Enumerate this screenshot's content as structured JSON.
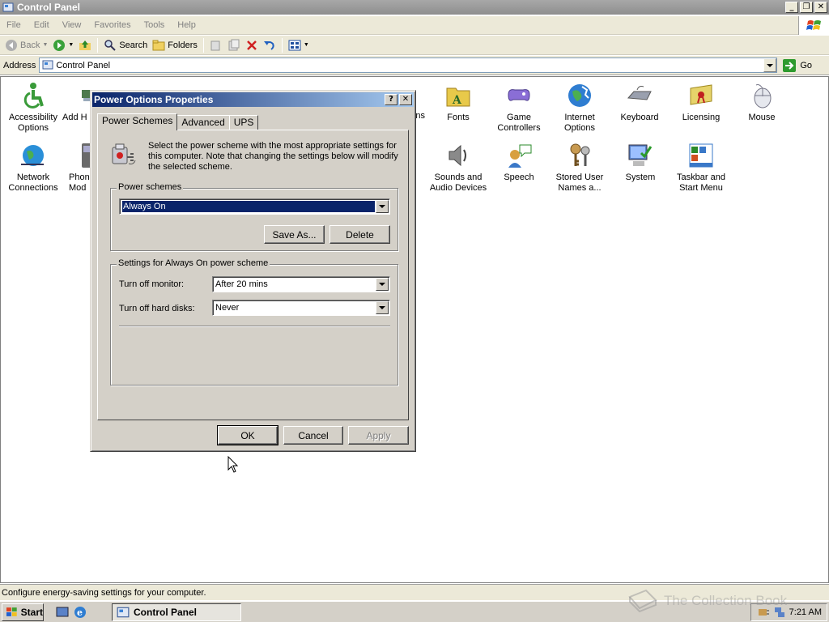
{
  "window": {
    "title": "Control Panel"
  },
  "menu": [
    "File",
    "Edit",
    "View",
    "Favorites",
    "Tools",
    "Help"
  ],
  "toolbar": {
    "back": "Back",
    "search": "Search",
    "folders": "Folders"
  },
  "address": {
    "label": "Address",
    "value": "Control Panel",
    "go": "Go"
  },
  "items": [
    {
      "name": "accessibility",
      "label": "Accessibility Options",
      "color": "#3a9b3a"
    },
    {
      "name": "add-hardware",
      "label": "Add H",
      "color": "#4e7a4e"
    },
    {
      "name": "fonts",
      "label": "Fonts",
      "color": "#e8c94a"
    },
    {
      "name": "game-controllers",
      "label": "Game Controllers",
      "color": "#8a6ed6"
    },
    {
      "name": "internet-options",
      "label": "Internet Options",
      "color": "#2f7dd1"
    },
    {
      "name": "keyboard",
      "label": "Keyboard",
      "color": "#9aa0ae"
    },
    {
      "name": "licensing",
      "label": "Licensing",
      "color": "#e6d36a"
    },
    {
      "name": "mouse",
      "label": "Mouse",
      "color": "#b8bcc6"
    },
    {
      "name": "network-connections",
      "label": "Network Connections",
      "color": "#2a8fd8"
    },
    {
      "name": "phone-modem",
      "label": "Phon Mod",
      "color": "#6a6a6a"
    },
    {
      "name": "sounds",
      "label": "Sounds and Audio Devices",
      "color": "#8a8a8a"
    },
    {
      "name": "speech",
      "label": "Speech",
      "color": "#d8a040"
    },
    {
      "name": "stored-user-names",
      "label": "Stored User Names a...",
      "color": "#c89a50"
    },
    {
      "name": "system",
      "label": "System",
      "color": "#5a82c8"
    },
    {
      "name": "taskbar",
      "label": "Taskbar and Start Menu",
      "color": "#3a78c8"
    }
  ],
  "partial_label": "ns",
  "status": "Configure energy-saving settings for your computer.",
  "taskbar": {
    "start": "Start",
    "task": "Control Panel",
    "clock": "7:21 AM",
    "watermark": "The Collection Book"
  },
  "dialog": {
    "title": "Power Options Properties",
    "help_btn": "?",
    "close_btn": "✕",
    "tabs": [
      "Power Schemes",
      "Advanced",
      "UPS"
    ],
    "intro": "Select the power scheme with the most appropriate settings for this computer. Note that changing the settings below will modify the selected scheme.",
    "schemes_legend": "Power schemes",
    "scheme_selected": "Always On",
    "save_as": "Save As...",
    "delete": "Delete",
    "settings_legend": "Settings for Always On power scheme",
    "monitor_label": "Turn off monitor:",
    "monitor_value": "After 20 mins",
    "disks_label": "Turn off hard disks:",
    "disks_value": "Never",
    "ok": "OK",
    "cancel": "Cancel",
    "apply": "Apply"
  }
}
